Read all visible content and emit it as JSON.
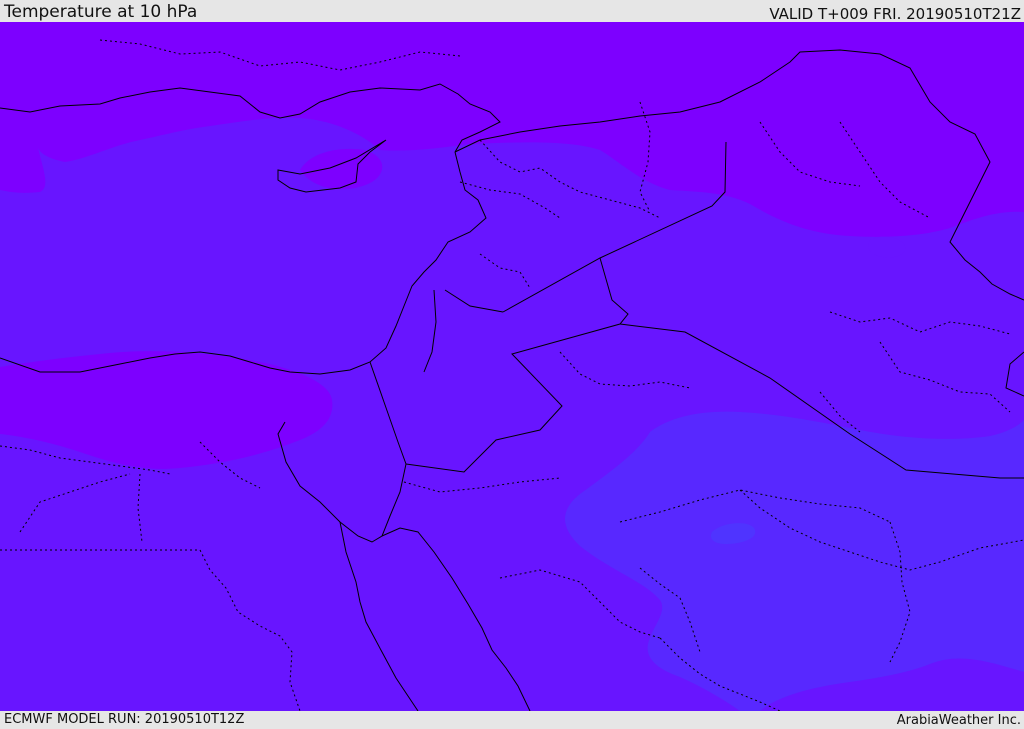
{
  "header": {
    "title": "Temperature at 10 hPa",
    "valid": "VALID T+009 FRI. 20190510T21Z"
  },
  "footer": {
    "run": "ECMWF MODEL RUN: 20190510T12Z",
    "credit": "ArabiaWeather Inc."
  },
  "colors": {
    "frame_background": "#e6e6e6",
    "band_warmest": "#7d00ff",
    "band_middle": "#6815ff",
    "band_cool": "#5828ff",
    "band_coolest": "#4f34ff",
    "borders": "#000000"
  }
}
